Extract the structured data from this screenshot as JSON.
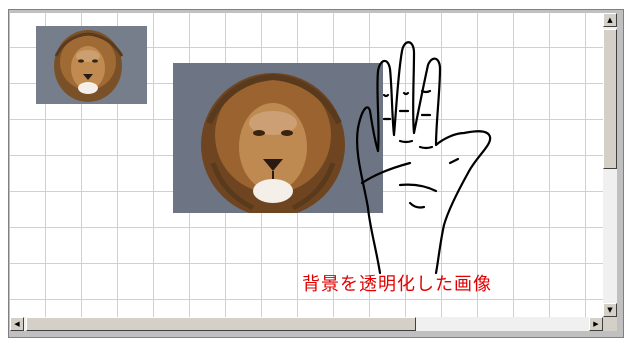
{
  "canvas": {
    "caption": "背景を透明化した画像",
    "caption_color": "#e00000",
    "grid_color": "#d0d0d0",
    "images": [
      {
        "name": "lion-photo-small"
      },
      {
        "name": "lion-photo-large"
      },
      {
        "name": "hand-outline-transparent"
      }
    ]
  },
  "scrollbars": {
    "vertical": {
      "up_icon": "arrow-up-icon",
      "down_icon": "arrow-down-icon"
    },
    "horizontal": {
      "left_icon": "arrow-left-icon",
      "right_icon": "arrow-right-icon"
    }
  }
}
